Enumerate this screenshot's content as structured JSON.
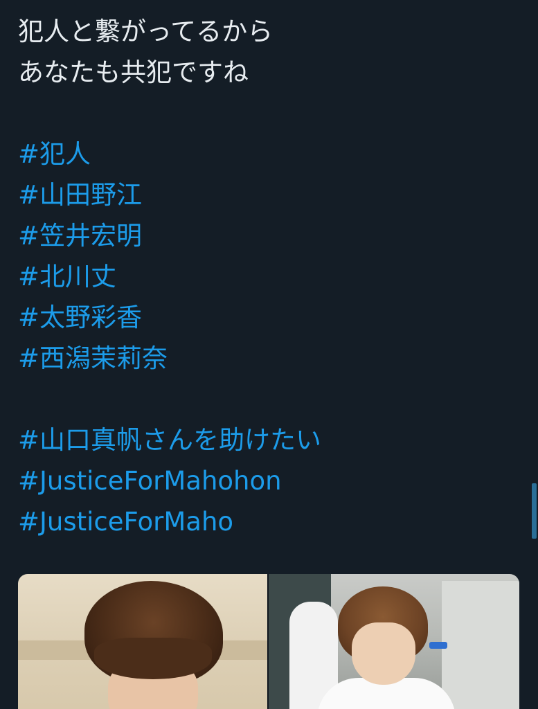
{
  "tweet": {
    "lines": [
      "犯人と繋がってるから",
      "あなたも共犯ですね"
    ],
    "hashtags_group_1": [
      "#犯人",
      "#山田野江",
      "#笠井宏明",
      "#北川丈",
      "#太野彩香",
      "#西潟茉莉奈"
    ],
    "hashtags_group_2": [
      "#山口真帆さんを助けたい",
      "#JusticeForMahohon",
      "#JusticeForMaho"
    ]
  },
  "colors": {
    "background": "#141d26",
    "text": "#e7ecf0",
    "hashtag": "#1c9cea"
  },
  "media": {
    "photo_count": 2
  }
}
